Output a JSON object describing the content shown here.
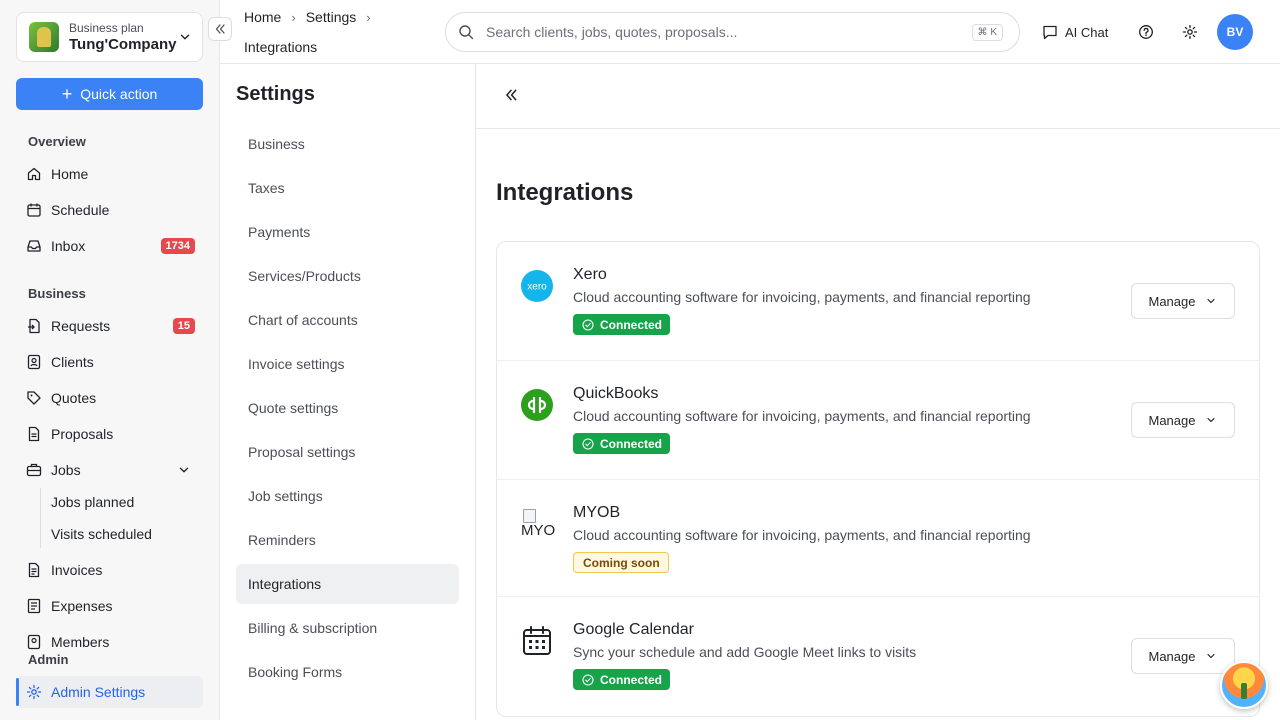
{
  "company": {
    "plan": "Business plan",
    "name": "Tung'Company"
  },
  "quick_action": "Quick action",
  "nav": {
    "overview_title": "Overview",
    "home": "Home",
    "schedule": "Schedule",
    "inbox": "Inbox",
    "inbox_badge": "1734",
    "business_title": "Business",
    "requests": "Requests",
    "requests_badge": "15",
    "clients": "Clients",
    "quotes": "Quotes",
    "proposals": "Proposals",
    "jobs": "Jobs",
    "jobs_planned": "Jobs planned",
    "visits_scheduled": "Visits scheduled",
    "invoices": "Invoices",
    "expenses": "Expenses",
    "members": "Members",
    "admin_title": "Admin",
    "admin_settings": "Admin Settings"
  },
  "breadcrumb": {
    "home": "Home",
    "settings": "Settings",
    "current": "Integrations"
  },
  "search": {
    "placeholder": "Search clients, jobs, quotes, proposals...",
    "shortcut": "⌘ K"
  },
  "topbar": {
    "ai_chat": "AI Chat",
    "avatar": "BV"
  },
  "settings": {
    "title": "Settings",
    "items": [
      "Business",
      "Taxes",
      "Payments",
      "Services/Products",
      "Chart of accounts",
      "Invoice settings",
      "Quote settings",
      "Proposal settings",
      "Job settings",
      "Reminders",
      "Integrations",
      "Billing & subscription",
      "Booking Forms"
    ],
    "active": "Integrations"
  },
  "main": {
    "title": "Integrations",
    "integrations": [
      {
        "name": "Xero",
        "description": "Cloud accounting software for invoicing, payments, and financial reporting",
        "status": "Connected",
        "action": "Manage",
        "icon": "xero-logo",
        "logo_text": "xero"
      },
      {
        "name": "QuickBooks",
        "description": "Cloud accounting software for invoicing, payments, and financial reporting",
        "status": "Connected",
        "action": "Manage",
        "icon": "quickbooks-logo"
      },
      {
        "name": "MYOB",
        "description": "Cloud accounting software for invoicing, payments, and financial reporting",
        "status": "Coming soon",
        "icon": "broken-image",
        "logo_alt": "MYOB"
      },
      {
        "name": "Google Calendar",
        "description": "Sync your schedule and add Google Meet links to visits",
        "status": "Connected",
        "action": "Manage",
        "icon": "calendar-icon"
      }
    ]
  }
}
